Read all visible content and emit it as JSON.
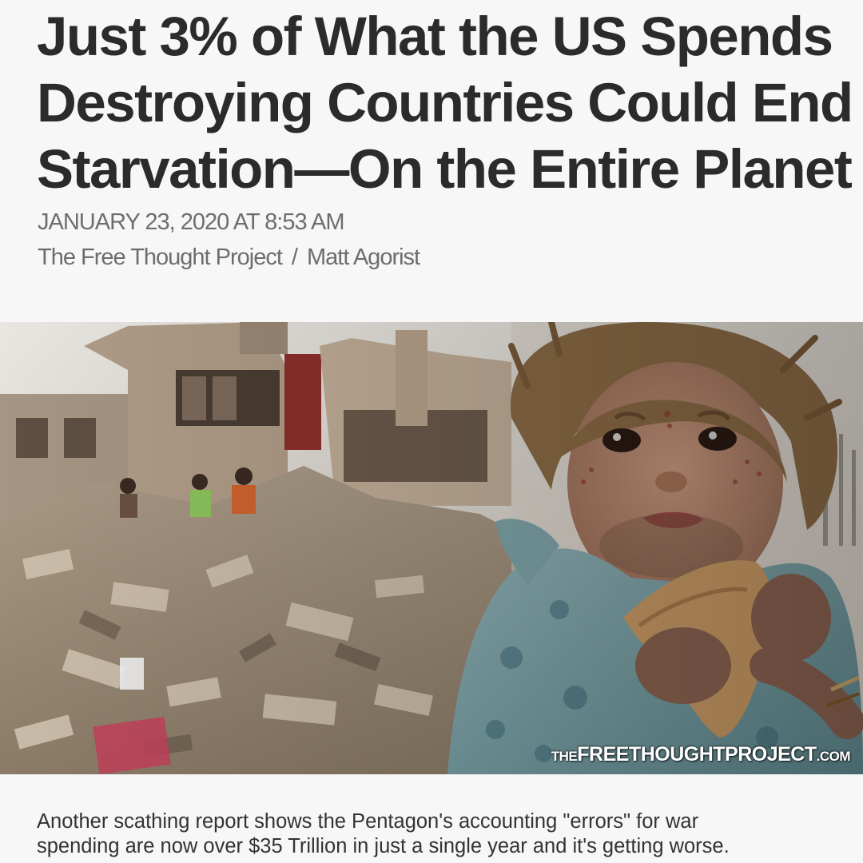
{
  "article": {
    "headline_lines": [
      "Just 3% of What the US Spends",
      "Destroying Countries Could End",
      "Starvation—On the Entire Planet"
    ],
    "date": "JANUARY 23, 2020 AT 8:53 AM",
    "source": "The Free Thought Project",
    "separator": "/",
    "author": "Matt Agorist",
    "summary_lines": [
      "Another scathing report shows the Pentagon's accounting \"errors\" for war",
      "spending are now over $35 Trillion in just a single year and it's getting worse."
    ]
  },
  "hero_image": {
    "watermark_prefix": "THE",
    "watermark_main": "FREETHOUGHTPROJECT",
    "watermark_suffix": ".COM"
  }
}
